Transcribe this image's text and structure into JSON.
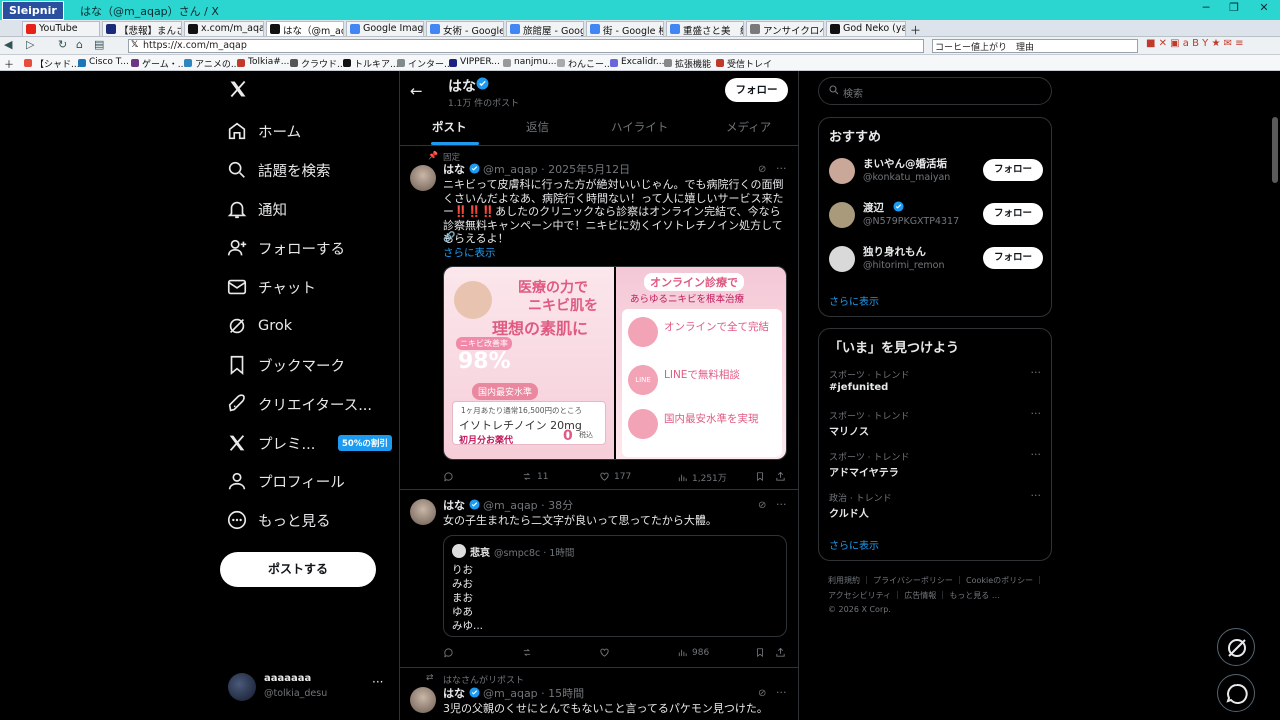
{
  "browser": {
    "logo": "Sleipnir",
    "window_title": "はな（@m_aqap）さん / X",
    "tabs": [
      {
        "label": "YouTube",
        "color": "#e62117"
      },
      {
        "label": "【悲報】まんさん「...",
        "color": "#1a2a7a"
      },
      {
        "label": "x.com/m_aqap/...",
        "color": "#111111"
      },
      {
        "label": "はな（@m_aqap...",
        "color": "#111111"
      },
      {
        "label": "Google Image R...",
        "color": "#4285f4"
      },
      {
        "label": "女術 - Google ...",
        "color": "#4285f4"
      },
      {
        "label": "旅館屋 - Googl...",
        "color": "#4285f4"
      },
      {
        "label": "街 - Google 検索",
        "color": "#4285f4"
      },
      {
        "label": "重盛さと美　紅...",
        "color": "#4285f4"
      },
      {
        "label": "アンサイクロペディ...",
        "color": "#7a7a7a"
      },
      {
        "label": "God Neko (yaye...",
        "color": "#111111"
      }
    ],
    "url": "https://x.com/m_aqap",
    "search_value": "コーヒー値上がり　理由",
    "bookmarks": [
      {
        "label": "【シャド...",
        "color": "#e74c3c"
      },
      {
        "label": "Cisco T...",
        "color": "#1b75bb"
      },
      {
        "label": "ゲーム・...",
        "color": "#6c3483"
      },
      {
        "label": "アニメの...",
        "color": "#2e86c1"
      },
      {
        "label": "Tolkia#...",
        "color": "#c0392b"
      },
      {
        "label": "クラウド...",
        "color": "#555555"
      },
      {
        "label": "トルキア...",
        "color": "#111111"
      },
      {
        "label": "インター...",
        "color": "#7f8c8d"
      },
      {
        "label": "VIPPER...",
        "color": "#1a237e"
      },
      {
        "label": "nanjmu...",
        "color": "#999999"
      },
      {
        "label": "わんこー...",
        "color": "#aaaaaa"
      },
      {
        "label": "Excalidr...",
        "color": "#6965db"
      },
      {
        "label": "拡張機能",
        "color": "#888888"
      },
      {
        "label": "受信トレイ",
        "color": "#c0392b"
      }
    ]
  },
  "nav": {
    "items": [
      {
        "label": "ホーム",
        "icon": "home-icon"
      },
      {
        "label": "話題を検索",
        "icon": "search-icon"
      },
      {
        "label": "通知",
        "icon": "bell-icon"
      },
      {
        "label": "フォローする",
        "icon": "follow-icon"
      },
      {
        "label": "チャット",
        "icon": "mail-icon"
      },
      {
        "label": "Grok",
        "icon": "grok-icon"
      },
      {
        "label": "ブックマーク",
        "icon": "bookmark-icon"
      },
      {
        "label": "クリエイタース...",
        "icon": "rocket-icon"
      },
      {
        "label": "プレミ...",
        "icon": "x-logo-icon"
      },
      {
        "label": "プロフィール",
        "icon": "person-icon"
      },
      {
        "label": "もっと見る",
        "icon": "more-circle-icon"
      }
    ],
    "premium_badge": "50%の割引",
    "post_button": "ポストする",
    "account": {
      "name": "aaaaaaa",
      "handle": "@tolkia_desu"
    }
  },
  "profile_header": {
    "name": "はな",
    "post_count": "1.1万 件のポスト",
    "follow": "フォロー",
    "tabs": [
      "ポスト",
      "返信",
      "ハイライト",
      "メディア"
    ]
  },
  "posts": [
    {
      "pinned": "固定",
      "name": "はな",
      "meta": "@m_aqap · 2025年5月12日",
      "text": "ニキビって皮膚科に行った方が絶対いいじゃん。でも病院行くの面倒くさいんだよなあ、病院行く時間ない！って人に嬉しいサービス来たー‼️‼️‼️あしたのクリニックなら診察はオンライン完結で、今なら診察無料キャンペーン中で！ニキビに効くイソトレチノイン処方してもらえるよ！",
      "more": "さらに表示",
      "ad_left": {
        "headline1": "医療の力で",
        "headline2": "ニキビ肌を",
        "headline3": "理想の素肌に",
        "rate_label": "ニキビ改善率",
        "rate": "98%",
        "tag": "国内最安水準",
        "price_note": "1ヶ月あたり通常16,500円のところ",
        "drug": "イソトレチノイン 20mg",
        "first": "初月分お薬代",
        "zero": "0",
        "tax": "税込"
      },
      "ad_right": {
        "title": "オンライン診療で",
        "subtitle": "あらゆるニキビを根本治療",
        "f1": "オンラインで全て完結",
        "f2": "LINEで無料相談",
        "f3": "国内最安水準を実現",
        "line": "LINE"
      },
      "replies": "",
      "reposts": "11",
      "likes": "177",
      "views": "1,251万"
    },
    {
      "name": "はな",
      "meta": "@m_aqap · 38分",
      "text": "女の子生まれたら二文字が良いって思ってたから大體。",
      "quote": {
        "name": "悲哀",
        "meta": "@smpc8c · 1時間",
        "lines": [
          "りお",
          "みお",
          "まお",
          "ゆあ",
          "みゆ..."
        ]
      },
      "views": "986"
    },
    {
      "repost_label": "はなさんがリポスト",
      "name": "はな",
      "meta": "@m_aqap · 15時間",
      "text": "3児の父親のくせにとんでもないこと言ってるパケモン見つけた。"
    }
  ],
  "right": {
    "search_placeholder": "検索",
    "recommend_title": "おすすめ",
    "recommend": [
      {
        "name": "まいやん@婚活垢",
        "handle": "@konkatu_maiyan",
        "follow": "フォロー",
        "color": "#c9a89a"
      },
      {
        "name": "渡辺",
        "handle": "@N579PKGXTP4317",
        "follow": "フォロー",
        "color": "#a89a7a"
      },
      {
        "name": "独り身れもん",
        "handle": "@hitorimi_remon",
        "follow": "フォロー",
        "color": "#d9d9d9"
      }
    ],
    "show_more": "さらに表示",
    "trends_title": "「いま」を見つけよう",
    "trends": [
      {
        "category": "スポーツ · トレンド",
        "title": "#jefunited"
      },
      {
        "category": "スポーツ · トレンド",
        "title": "マリノス"
      },
      {
        "category": "スポーツ · トレンド",
        "title": "アドマイヤテラ"
      },
      {
        "category": "政治 · トレンド",
        "title": "クルド人"
      }
    ],
    "trends_more": "さらに表示",
    "footer": [
      [
        "利用規約",
        "プライバシーポリシー",
        "Cookieのポリシー"
      ],
      [
        "アクセシビリティ",
        "広告情報",
        "もっと見る …"
      ],
      [
        "© 2026 X Corp."
      ]
    ]
  },
  "colors": {
    "accent": "#1d9bf0",
    "chrome": "#2bd6d0",
    "ad_pink": "#f3a3b6"
  }
}
